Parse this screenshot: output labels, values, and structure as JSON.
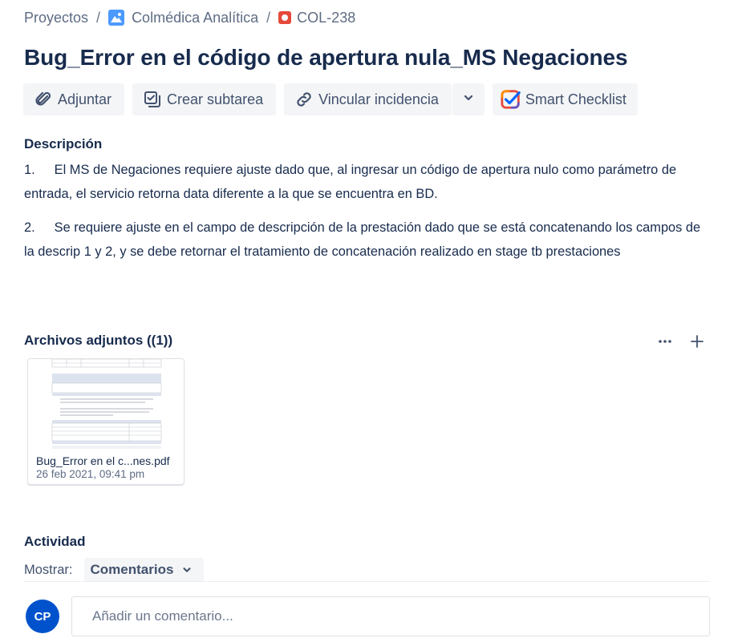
{
  "breadcrumb": {
    "root": "Proyectos",
    "project": "Colmédica Analítica",
    "issue_key": "COL-238",
    "separator": "/"
  },
  "issue": {
    "title": "Bug_Error en el código de apertura nula_MS Negaciones"
  },
  "toolbar": {
    "attach_label": "Adjuntar",
    "subtask_label": "Crear subtarea",
    "link_label": "Vincular incidencia",
    "smart_checklist_label": "Smart Checklist"
  },
  "description": {
    "label": "Descripción",
    "items": [
      {
        "num": "1.",
        "text": "El MS de Negaciones requiere ajuste dado que, al ingresar un código de apertura nulo como parámetro de entrada, el servicio retorna data diferente a la que se encuentra en BD."
      },
      {
        "num": "2.",
        "text": "Se requiere ajuste en el campo de descripción de la prestación dado que se está concatenando los campos de la descrip 1 y 2, y se debe retornar el tratamiento de concatenación realizado en stage tb prestaciones"
      }
    ]
  },
  "attachments": {
    "label": "Archivos adjuntos ((1))",
    "files": [
      {
        "name": "Bug_Error en el c...nes.pdf",
        "date": "26 feb 2021, 09:41 pm"
      }
    ]
  },
  "activity": {
    "label": "Actividad",
    "show_label": "Mostrar:",
    "show_value": "Comentarios",
    "avatar_initials": "CP",
    "comment_placeholder": "Añadir un comentario..."
  },
  "colors": {
    "text": "#172b4d",
    "subtle": "#42526e",
    "button_bg": "#f4f5f7",
    "avatar": "#0052cc",
    "bug_red": "#e5493a",
    "project_blue": "#4c9aff"
  }
}
